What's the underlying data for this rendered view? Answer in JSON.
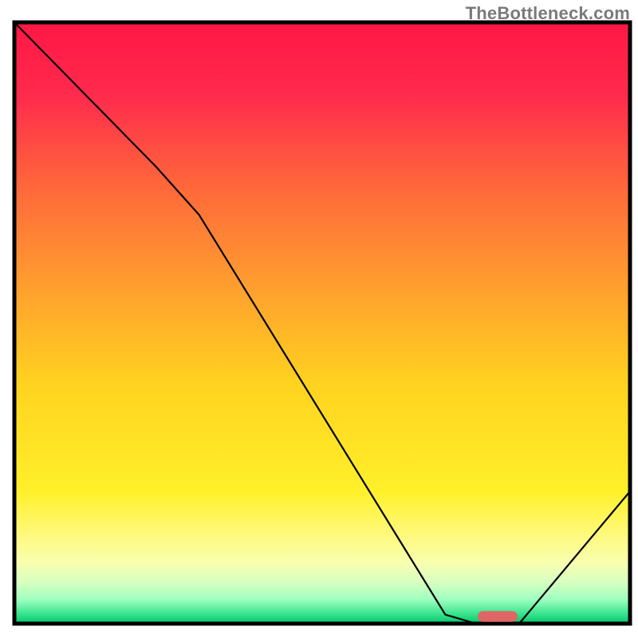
{
  "watermark": "TheBottleneck.com",
  "chart_data": {
    "type": "line",
    "title": "",
    "xlabel": "",
    "ylabel": "",
    "xlim": [
      0,
      100
    ],
    "ylim": [
      0,
      100
    ],
    "axes_visible": false,
    "grid": false,
    "background_gradient": {
      "stops": [
        {
          "offset": 0.0,
          "color": "#ff1744"
        },
        {
          "offset": 0.12,
          "color": "#ff2a4d"
        },
        {
          "offset": 0.28,
          "color": "#ff6a3a"
        },
        {
          "offset": 0.45,
          "color": "#ffa22e"
        },
        {
          "offset": 0.6,
          "color": "#ffd21f"
        },
        {
          "offset": 0.78,
          "color": "#fff02a"
        },
        {
          "offset": 0.85,
          "color": "#fff97a"
        },
        {
          "offset": 0.9,
          "color": "#f7ffb0"
        },
        {
          "offset": 0.93,
          "color": "#d9ffc0"
        },
        {
          "offset": 0.96,
          "color": "#9effc0"
        },
        {
          "offset": 0.985,
          "color": "#33e28a"
        },
        {
          "offset": 1.0,
          "color": "#00c46a"
        }
      ]
    },
    "frame_color": "#000000",
    "curve": {
      "stroke": "#000000",
      "stroke_width": 2.2,
      "points_norm": [
        {
          "x": 0.0,
          "y": 1.0
        },
        {
          "x": 0.23,
          "y": 0.76
        },
        {
          "x": 0.3,
          "y": 0.68
        },
        {
          "x": 0.7,
          "y": 0.015
        },
        {
          "x": 0.75,
          "y": 0.0
        },
        {
          "x": 0.82,
          "y": 0.0
        },
        {
          "x": 1.0,
          "y": 0.22
        }
      ]
    },
    "marker": {
      "shape": "rounded-rect",
      "color": "#e06666",
      "x_norm": 0.785,
      "y_norm": 0.003,
      "width_norm": 0.065,
      "height_norm": 0.018,
      "rx_norm": 0.009
    },
    "note": "Values are normalized fractions of the plotting rectangle; y is measured from the bottom axis upward. Chart has no numeric ticks or labels visible."
  }
}
